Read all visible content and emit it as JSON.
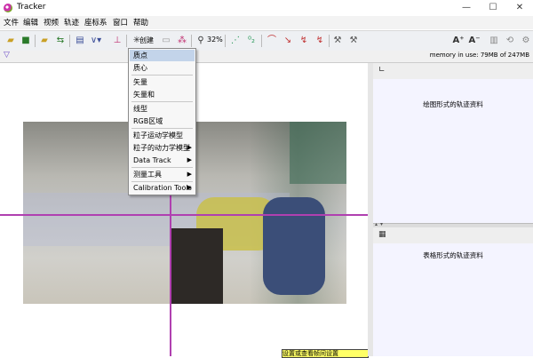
{
  "window": {
    "title": "Tracker",
    "controls": [
      "—",
      "☐",
      "✕"
    ]
  },
  "menubar": [
    "文件",
    "编辑",
    "视频",
    "轨迹",
    "座标系",
    "窗口",
    "帮助"
  ],
  "toolbar": {
    "create_label": "创建",
    "zoom": "32%"
  },
  "status": {
    "memory": "memory in use: 79MB of 247MB"
  },
  "dropdown": {
    "items": [
      {
        "label": "质点",
        "highlighted": true
      },
      {
        "label": "质心"
      },
      {
        "label": "矢量"
      },
      {
        "label": "矢量和"
      },
      {
        "label": "线型"
      },
      {
        "label": "RGB区域"
      },
      {
        "label": "粒子运动学模型"
      },
      {
        "label": "粒子的动力学模型",
        "submenu": true
      },
      {
        "label": "Data Track",
        "submenu": true
      },
      {
        "label": "测量工具",
        "submenu": true
      },
      {
        "label": "Calibration Tools",
        "submenu": true
      }
    ]
  },
  "right_panels": {
    "plot_text": "绘图形式的轨迹资料",
    "table_text": "表格形式的轨迹资料"
  },
  "video": {
    "caption": "设置或查看帧间设置"
  },
  "colors": {
    "axis": "#b040b0",
    "highlight": "#c3d4ea"
  }
}
